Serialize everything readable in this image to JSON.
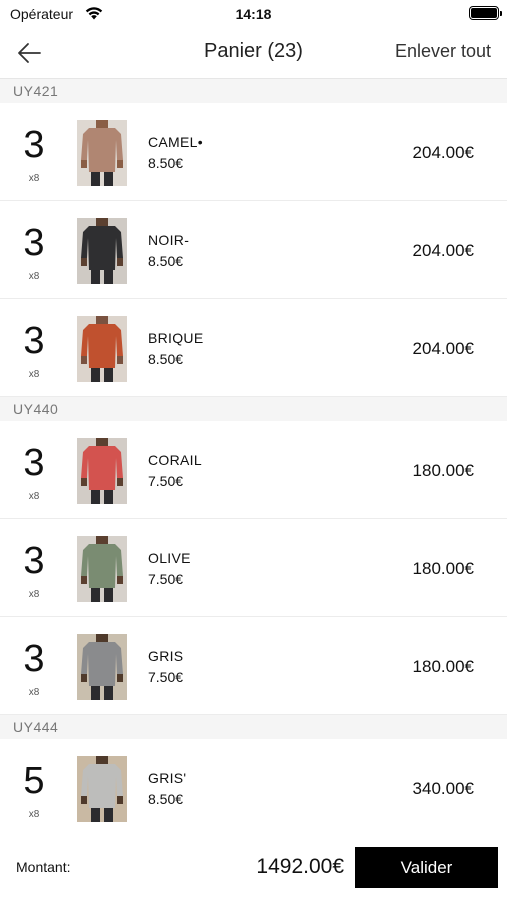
{
  "status": {
    "carrier": "Opérateur",
    "time": "14:18"
  },
  "nav": {
    "title": "Panier (23)",
    "action_label": "Enlever tout"
  },
  "sections": [
    {
      "code": "UY421",
      "items": [
        {
          "qty": "3",
          "multiplier": "x8",
          "name": "CAMEL•",
          "unit_price": "8.50€",
          "total": "204.00€",
          "shirt_color": "#b08672",
          "bg_color": "#ded8d1",
          "skin": "#8a5e45"
        },
        {
          "qty": "3",
          "multiplier": "x8",
          "name": "NOIR-",
          "unit_price": "8.50€",
          "total": "204.00€",
          "shirt_color": "#2f2f31",
          "bg_color": "#cfcac4",
          "skin": "#5b4030"
        },
        {
          "qty": "3",
          "multiplier": "x8",
          "name": "BRIQUE",
          "unit_price": "8.50€",
          "total": "204.00€",
          "shirt_color": "#c0512f",
          "bg_color": "#dcd4cc",
          "skin": "#7a5240"
        }
      ]
    },
    {
      "code": "UY440",
      "items": [
        {
          "qty": "3",
          "multiplier": "x8",
          "name": "CORAIL",
          "unit_price": "7.50€",
          "total": "180.00€",
          "shirt_color": "#d3534f",
          "bg_color": "#d2ccc6",
          "skin": "#5b4030"
        },
        {
          "qty": "3",
          "multiplier": "x8",
          "name": "OLIVE",
          "unit_price": "7.50€",
          "total": "180.00€",
          "shirt_color": "#7a8c72",
          "bg_color": "#d6d1cb",
          "skin": "#5b4030"
        },
        {
          "qty": "3",
          "multiplier": "x8",
          "name": "GRIS",
          "unit_price": "7.50€",
          "total": "180.00€",
          "shirt_color": "#8a8b8d",
          "bg_color": "#c9bfae",
          "skin": "#4f3a2b"
        }
      ]
    },
    {
      "code": "UY444",
      "items": [
        {
          "qty": "5",
          "multiplier": "x8",
          "name": "GRIS'",
          "unit_price": "8.50€",
          "total": "340.00€",
          "shirt_color": "#bdbdbb",
          "bg_color": "#c9b9a3",
          "skin": "#4f3a2b"
        }
      ]
    }
  ],
  "footer": {
    "label": "Montant:",
    "amount": "1492.00€",
    "button_label": "Valider"
  }
}
